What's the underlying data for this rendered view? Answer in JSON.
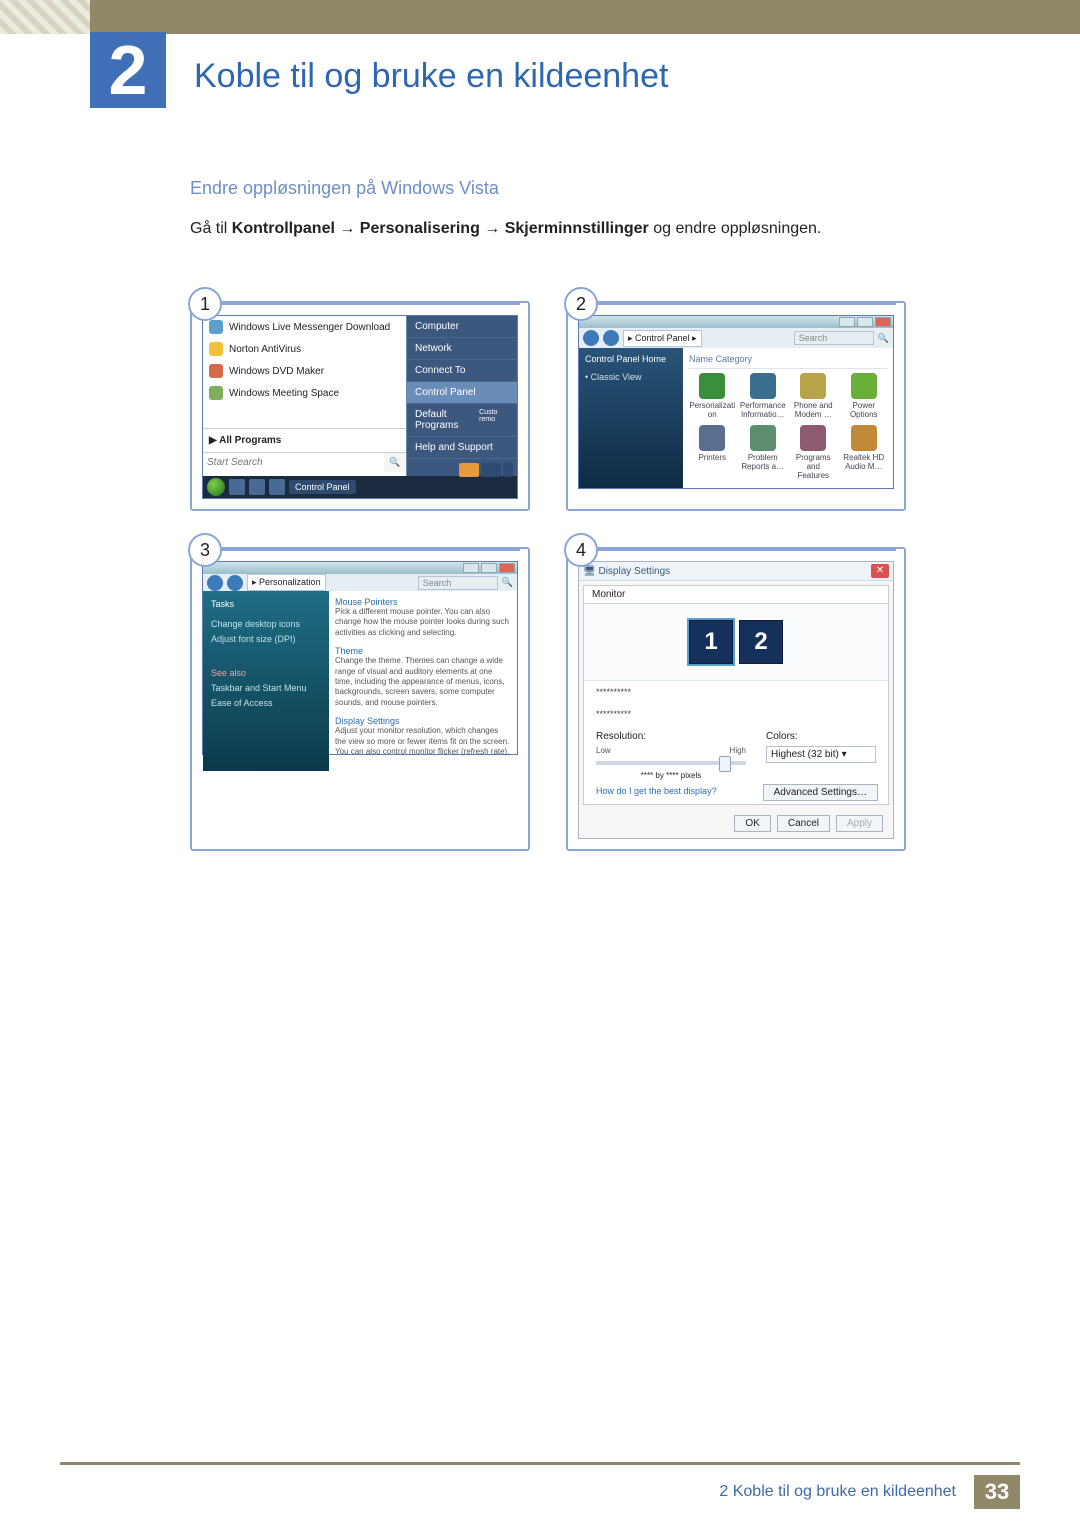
{
  "header": {
    "chapter_number": "2",
    "chapter_title": "Koble til og bruke en kildeenhet"
  },
  "section": {
    "title": "Endre oppløsningen på Windows Vista",
    "intro_prefix": "Gå til ",
    "intro_b1": "Kontrollpanel",
    "intro_arrow": " → ",
    "intro_b2": "Personalisering",
    "intro_b3": "Skjerminnstillinger",
    "intro_suffix": " og endre oppløsningen."
  },
  "fig1": {
    "badge": "1",
    "left_items": [
      "Windows Live Messenger Download",
      "Norton AntiVirus",
      "Windows DVD Maker",
      "Windows Meeting Space"
    ],
    "all_programs": "All Programs",
    "search_placeholder": "Start Search",
    "right_items": [
      "Computer",
      "Network",
      "Connect To",
      "Control Panel",
      "Default Programs",
      "Help and Support"
    ],
    "right_highlight_index": 3,
    "right_extra": "Custo remo",
    "taskbar_label": "Control Panel"
  },
  "fig2": {
    "badge": "2",
    "breadcrumb": "Control Panel",
    "search_placeholder": "Search",
    "side_home": "Control Panel Home",
    "side_classic": "Classic View",
    "grid_header": "Name        Category",
    "icons": [
      {
        "label": "Personalizati on",
        "color": "#3b8e3b"
      },
      {
        "label": "Performance Informatio…",
        "color": "#3b6f8e"
      },
      {
        "label": "Phone and Modem …",
        "color": "#b8a24a"
      },
      {
        "label": "Power Options",
        "color": "#6aae3a"
      },
      {
        "label": "Printers",
        "color": "#5a6f8e"
      },
      {
        "label": "Problem Reports a…",
        "color": "#5a8e6f"
      },
      {
        "label": "Programs and Features",
        "color": "#8e5a6f"
      },
      {
        "label": "Realtek HD Audio M…",
        "color": "#c08a3a"
      }
    ]
  },
  "fig3": {
    "badge": "3",
    "breadcrumb": "Personalization",
    "search_placeholder": "Search",
    "side_tasks": "Tasks",
    "side_links": [
      "Change desktop icons",
      "Adjust font size (DPI)"
    ],
    "see_also": "See also",
    "see_also_items": [
      "Taskbar and Start Menu",
      "Ease of Access"
    ],
    "items": [
      {
        "hd": "Mouse Pointers",
        "ds": "Pick a different mouse pointer. You can also change how the mouse pointer looks during such activities as clicking and selecting."
      },
      {
        "hd": "Theme",
        "ds": "Change the theme. Themes can change a wide range of visual and auditory elements at one time, including the appearance of menus, icons, backgrounds, screen savers, some computer sounds, and mouse pointers."
      },
      {
        "hd": "Display Settings",
        "ds": "Adjust your monitor resolution, which changes the view so more or fewer items fit on the screen. You can also control monitor flicker (refresh rate)."
      }
    ]
  },
  "fig4": {
    "badge": "4",
    "title": "Display Settings",
    "tab": "Monitor",
    "mon1": "1",
    "mon2": "2",
    "stars1": "**********",
    "stars2": "**********",
    "res_label": "Resolution:",
    "low": "Low",
    "high": "High",
    "res_value": "**** by **** pixels",
    "colors_label": "Colors:",
    "colors_value": "Highest (32 bit)",
    "help_link": "How do I get the best display?",
    "adv_btn": "Advanced Settings…",
    "ok": "OK",
    "cancel": "Cancel",
    "apply": "Apply"
  },
  "footer": {
    "text": "2 Koble til og bruke en kildeenhet",
    "page": "33"
  }
}
